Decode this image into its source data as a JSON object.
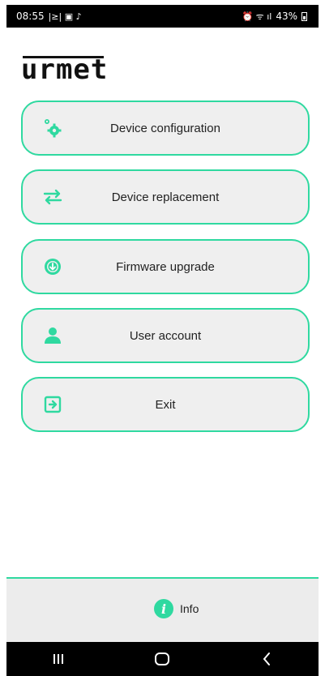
{
  "status_bar": {
    "time": "08:55",
    "left_glyphs": "|≥| ▣ ♪",
    "right_glyphs": "⏰ ᯤ ıl",
    "battery": "43%"
  },
  "brand": {
    "logo_text": "urmet"
  },
  "menu": [
    {
      "label": "Device configuration",
      "icon": "gear-icon"
    },
    {
      "label": "Device replacement",
      "icon": "swap-arrows-icon"
    },
    {
      "label": "Firmware upgrade",
      "icon": "download-circle-icon"
    },
    {
      "label": "User account",
      "icon": "user-icon"
    },
    {
      "label": "Exit",
      "icon": "exit-icon"
    }
  ],
  "footer": {
    "info_label": "Info",
    "info_glyph": "i"
  },
  "colors": {
    "accent": "#2fd9a0",
    "button_bg": "#efefef",
    "panel_bg": "#ececec"
  }
}
